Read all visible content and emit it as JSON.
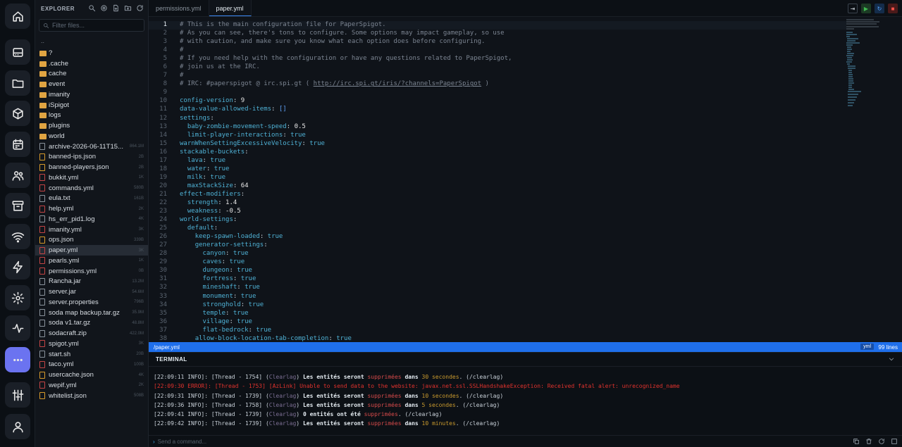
{
  "explorer": {
    "title": "EXPLORER",
    "filter_placeholder": "Filter files...",
    "parent": "..",
    "items": [
      {
        "name": "?",
        "type": "folder",
        "size": ""
      },
      {
        "name": ".cache",
        "type": "folder",
        "size": ""
      },
      {
        "name": "cache",
        "type": "folder",
        "size": ""
      },
      {
        "name": "event",
        "type": "folder",
        "size": ""
      },
      {
        "name": "imanity",
        "type": "folder",
        "size": ""
      },
      {
        "name": "iSpigot",
        "type": "folder",
        "size": ""
      },
      {
        "name": "logs",
        "type": "folder",
        "size": ""
      },
      {
        "name": "plugins",
        "type": "folder",
        "size": ""
      },
      {
        "name": "world",
        "type": "folder",
        "size": ""
      },
      {
        "name": "archive-2026-06-11T15...",
        "type": "file",
        "size": "864.1M"
      },
      {
        "name": "banned-ips.json",
        "type": "json",
        "size": "2B"
      },
      {
        "name": "banned-players.json",
        "type": "json",
        "size": "2B"
      },
      {
        "name": "bukkit.yml",
        "type": "yml",
        "size": "1K"
      },
      {
        "name": "commands.yml",
        "type": "yml",
        "size": "580B"
      },
      {
        "name": "eula.txt",
        "type": "file",
        "size": "161B"
      },
      {
        "name": "help.yml",
        "type": "yml",
        "size": "2K"
      },
      {
        "name": "hs_err_pid1.log",
        "type": "file",
        "size": "4K"
      },
      {
        "name": "imanity.yml",
        "type": "yml",
        "size": "3K"
      },
      {
        "name": "ops.json",
        "type": "json",
        "size": "339B"
      },
      {
        "name": "paper.yml",
        "type": "yml",
        "size": "3K"
      },
      {
        "name": "pearls.yml",
        "type": "yml",
        "size": "1K"
      },
      {
        "name": "permissions.yml",
        "type": "yml",
        "size": "0B"
      },
      {
        "name": "Rancha.jar",
        "type": "file",
        "size": "13.2M"
      },
      {
        "name": "server.jar",
        "type": "file",
        "size": "54.6M"
      },
      {
        "name": "server.properties",
        "type": "file",
        "size": "796B"
      },
      {
        "name": "soda map backup.tar.gz",
        "type": "file",
        "size": "35.9M"
      },
      {
        "name": "soda v1.tar.gz",
        "type": "file",
        "size": "48.8M"
      },
      {
        "name": "sodacraft.zip",
        "type": "file",
        "size": "422.0M"
      },
      {
        "name": "spigot.yml",
        "type": "yml",
        "size": "3K"
      },
      {
        "name": "start.sh",
        "type": "file",
        "size": "20B"
      },
      {
        "name": "taco.yml",
        "type": "yml",
        "size": "100B"
      },
      {
        "name": "usercache.json",
        "type": "json",
        "size": "4K"
      },
      {
        "name": "wepif.yml",
        "type": "yml",
        "size": "2K"
      },
      {
        "name": "whitelist.json",
        "type": "json",
        "size": "508B"
      }
    ]
  },
  "tabs": [
    {
      "label": "permissions.yml",
      "active": false
    },
    {
      "label": "paper.yml",
      "active": true
    }
  ],
  "code": [
    "# This is the main configuration file for PaperSpigot.",
    "# As you can see, there's tons to configure. Some options may impact gameplay, so use",
    "# with caution, and make sure you know what each option does before configuring.",
    "#",
    "# If you need help with the configuration or have any questions related to PaperSpigot,",
    "# join us at the IRC.",
    "#",
    "# IRC: #paperspigot @ irc.spi.gt ( http://irc.spi.gt/iris/?channels=PaperSpigot )",
    "",
    "config-version: 9",
    "data-value-allowed-items: []",
    "settings:",
    "  baby-zombie-movement-speed: 0.5",
    "  limit-player-interactions: true",
    "warnWhenSettingExcessiveVelocity: true",
    "stackable-buckets:",
    "  lava: true",
    "  water: true",
    "  milk: true",
    "  maxStackSize: 64",
    "effect-modifiers:",
    "  strength: 1.4",
    "  weakness: -0.5",
    "world-settings:",
    "  default:",
    "    keep-spawn-loaded: true",
    "    generator-settings:",
    "      canyon: true",
    "      caves: true",
    "      dungeon: true",
    "      fortress: true",
    "      mineshaft: true",
    "      monument: true",
    "      stronghold: true",
    "      temple: true",
    "      village: true",
    "      flat-bedrock: true",
    "    allow-block-location-tab-completion: true"
  ],
  "status": {
    "path": "/paper.yml",
    "lang": "yml",
    "lines": "99 lines"
  },
  "terminal": {
    "title": "TERMINAL",
    "placeholder": "Send a command...",
    "lines": [
      {
        "kind": "info",
        "time": "[22:09:11 INFO]: ",
        "thread": "[Thread - 1754] ",
        "tag": "Clearlag",
        "pre": " Les entités seront ",
        "mid": "supprimées",
        "post": " dans ",
        "num": "30 secondes",
        "end": ". (/clearlag)"
      },
      {
        "kind": "error",
        "text": "[22:09:30 ERROR]: [Thread - 1753] [AzLink] Unable to send data to the website: javax.net.ssl.SSLHandshakeException: Received fatal alert: unrecognized_name"
      },
      {
        "kind": "info",
        "time": "[22:09:31 INFO]: ",
        "thread": "[Thread - 1739] ",
        "tag": "Clearlag",
        "pre": " Les entités seront ",
        "mid": "supprimées",
        "post": " dans ",
        "num": "10 secondes",
        "end": ". (/clearlag)"
      },
      {
        "kind": "info",
        "time": "[22:09:36 INFO]: ",
        "thread": "[Thread - 1758] ",
        "tag": "Clearlag",
        "pre": " Les entités seront ",
        "mid": "supprimées",
        "post": " dans ",
        "num": "5 secondes",
        "end": ". (/clearlag)"
      },
      {
        "kind": "info2",
        "time": "[22:09:41 INFO]: ",
        "thread": "[Thread - 1739] ",
        "tag": "Clearlag",
        "pre": " 0 entités ont été ",
        "mid": "supprimées",
        "post": ". (/clearlag)",
        "num": "",
        "end": ""
      },
      {
        "kind": "info",
        "time": "[22:09:42 INFO]: ",
        "thread": "[Thread - 1739] ",
        "tag": "Clearlag",
        "pre": " Les entités seront ",
        "mid": "supprimées",
        "post": " dans ",
        "num": "10 minutes",
        "end": ". (/clearlag)"
      }
    ]
  },
  "rail": [
    "home-icon",
    "drive-icon",
    "folder-icon",
    "box-icon",
    "calendar-icon",
    "users-icon",
    "archive-icon",
    "wifi-icon",
    "bolt-icon",
    "gear-icon",
    "activity-icon",
    "more-icon",
    "sliders-icon",
    "user-icon"
  ]
}
